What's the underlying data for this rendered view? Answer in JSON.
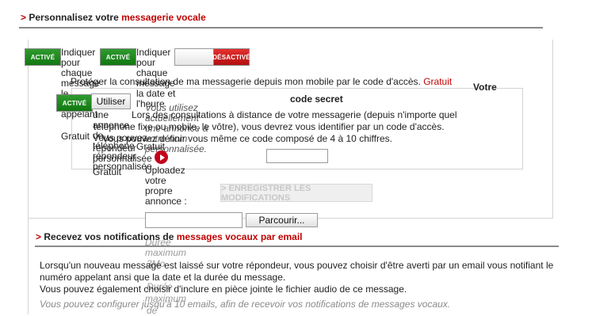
{
  "section1": {
    "gt": ">",
    "title_plain": "Personnalisez votre ",
    "title_red": "messagerie vocale"
  },
  "toggles": {
    "active": "ACTIVÉ",
    "inactive": "DÉSACTIVÉ"
  },
  "option1": {
    "text": "Indiquer pour chaque message le numéro appelant"
  },
  "option2": {
    "text": "Indiquer pour chaque message la date et l'heure"
  },
  "greeting": {
    "use_button": "Utiliser",
    "text1": "une annonce de téléphone répondeur personnalisée",
    "free": "Gratuit",
    "you_can": "Vous pouvez",
    "repondeur": "répondeur",
    "perso": "personnalisée",
    "gratuit2": "Gratuit"
  },
  "annonce": {
    "current": "Vous utilisez actuellement une annonce à votre nom personnalisée.",
    "free": "Gratuit",
    "upload": "Uploadez votre propre annonce :",
    "browse": "Parcourir...",
    "max": "Durée maximum",
    "size": "3Mo",
    "duree2": "Durée",
    "max2": "maximum",
    "de": "de"
  },
  "secret": {
    "intro": "Protéger la consultation de ma messagerie depuis mon mobile par le code d'accès. ",
    "intro_red": "Gratuit",
    "side_title": "Votre",
    "title": "code secret",
    "line1": "Lors des consultations à distance de votre messagerie (depuis n'importe quel",
    "line2": "téléphone fixe ou mobile, le vôtre), vous devrez vous identifier par un code d'accès.",
    "line3": "Vous pouvez définir vous même ce code composé de 4 à 10 chiffres.",
    "save": "> ENREGISTRER LES MODIFICATIONS"
  },
  "section2": {
    "gt": ">",
    "title_plain": "Recevez vos notifications de ",
    "title_red": "messages vocaux par email",
    "p1a": "Lorsqu'un nouveau message est laissé sur votre répondeur, vous pouvez choisir d'être averti par un email vous notifiant le",
    "p1b": "numéro appelant ansi que la date et la durée du message.",
    "p2": "Vous pouvez également choisir d'inclure en pièce jointe le fichier audio de ce message.",
    "note": "Vous pouvez configurer jusqu'à 10 emails, afin de recevoir vos notifications de messages vocaux."
  }
}
